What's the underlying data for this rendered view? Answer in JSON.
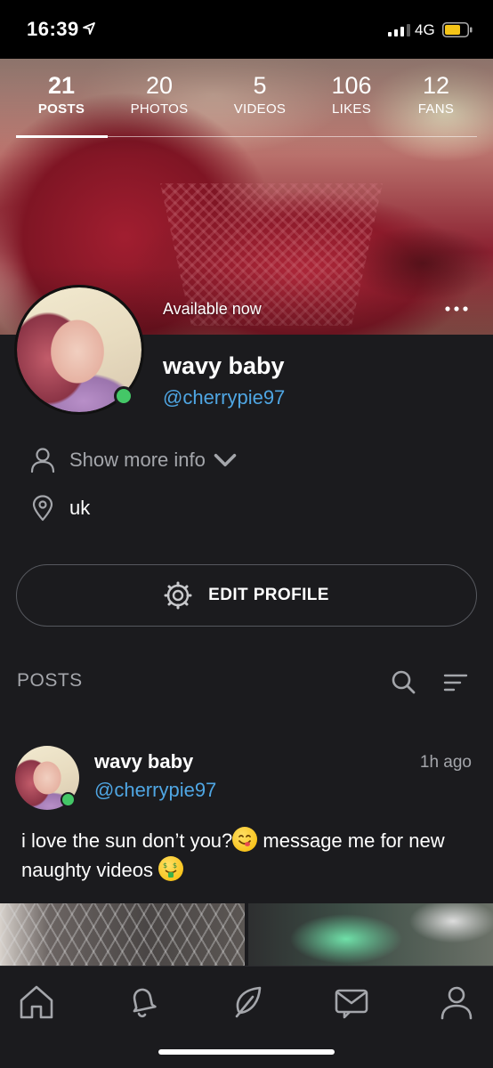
{
  "status_bar": {
    "time": "16:39",
    "network": "4G",
    "battery_color": "#f5c518"
  },
  "profile": {
    "stats": [
      {
        "value": "21",
        "label": "POSTS",
        "active": true
      },
      {
        "value": "20",
        "label": "PHOTOS",
        "active": false
      },
      {
        "value": "5",
        "label": "VIDEOS",
        "active": false
      },
      {
        "value": "106",
        "label": "LIKES",
        "active": false
      },
      {
        "value": "12",
        "label": "FANS",
        "active": false
      }
    ],
    "availability": "Available now",
    "display_name": "wavy baby",
    "handle": "@cherrypie97",
    "show_more_info": "Show more info",
    "location": "uk",
    "edit_profile_label": "EDIT PROFILE"
  },
  "posts_section": {
    "title": "POSTS"
  },
  "post": {
    "author_name": "wavy baby",
    "author_handle": "@cherrypie97",
    "time_ago": "1h ago",
    "text_part1": "i love the sun don’t you?",
    "text_part2": " message me for new naughty videos "
  },
  "colors": {
    "background": "#1b1b1e",
    "link_blue": "#4fa6e3",
    "online_green": "#44c767",
    "muted_text": "#a4a6ab"
  },
  "tab_bar": {
    "icons": [
      "home-icon",
      "bell-icon",
      "feather-icon",
      "message-icon",
      "profile-icon"
    ]
  }
}
